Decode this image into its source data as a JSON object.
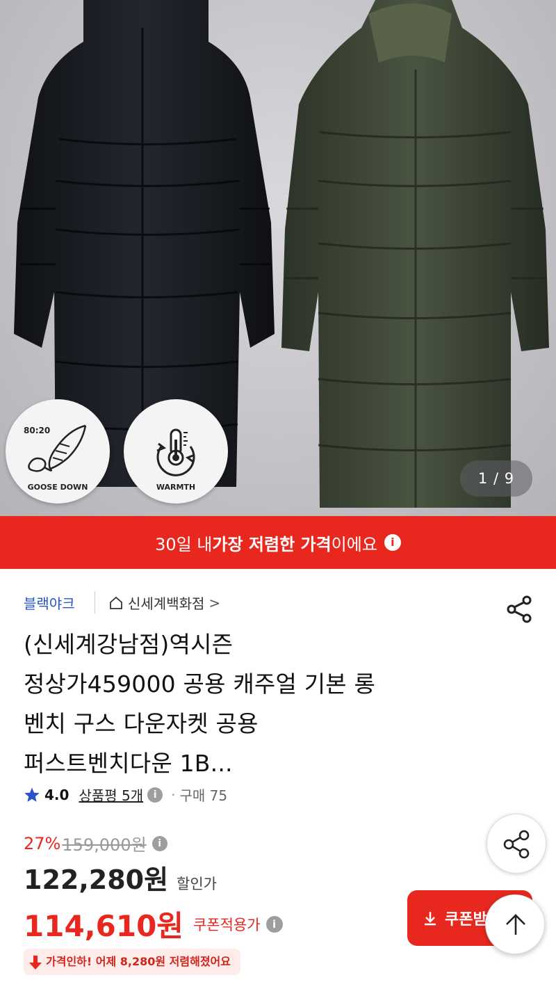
{
  "gallery": {
    "counter": "1 / 9",
    "badges": [
      {
        "ratio": "80:20",
        "label": "GOOSE DOWN",
        "icon": "feather-icon"
      },
      {
        "label": "WARMTH",
        "icon": "thermometer-icon"
      }
    ]
  },
  "banner": {
    "pre": "30일 내 ",
    "bold": "가장 저렴한 가격",
    "post": "이에요",
    "info": "i"
  },
  "brand": {
    "name": "블랙야크",
    "store": "신세계백화점",
    "store_chevron": ">"
  },
  "title_lines": [
    "(신세계강남점)역시즌",
    "정상가459000  공용 캐주얼 기본 롱",
    "벤치 구스 다운자켓 공용",
    "퍼스트벤치다운 1B..."
  ],
  "rating": {
    "score": "4.0",
    "reviews": "상품평 5개",
    "info": "i",
    "dot": "·",
    "purchases": "구매 75"
  },
  "price": {
    "discount_pct": "27%",
    "original": "159,000원",
    "sale": "122,280원",
    "sale_label": "할인가",
    "coupon_price": "114,610원",
    "coupon_label": "쿠폰적용가",
    "info": "i",
    "drop_notice": "가격인하! 어제 8,280원 저렴해졌어요"
  },
  "buttons": {
    "coupon": "쿠폰받"
  },
  "colors": {
    "accent_red": "#e8281f",
    "brand_blue": "#2a54c9",
    "star": "#2a54c9"
  }
}
